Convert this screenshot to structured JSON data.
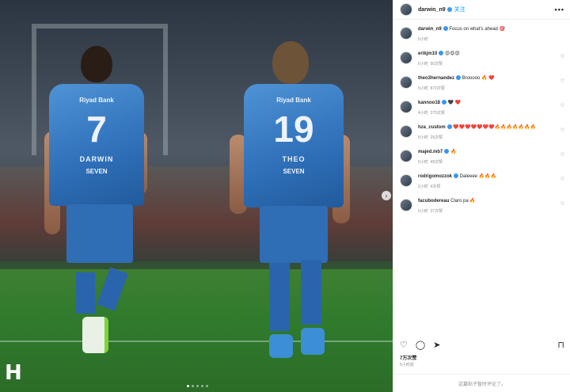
{
  "post": {
    "author": "darwin_n9",
    "follow_label": "关注",
    "more_label": "•••",
    "caption": {
      "user": "darwin_n9",
      "text": "Focus on what's ahead 🎯",
      "time": "5小时"
    },
    "comments": [
      {
        "user": "erikjm10",
        "text": "😍😍😍",
        "time": "5小时",
        "likes": "50次赞"
      },
      {
        "user": "theo3hernandez",
        "text": "Brooooo 🔥 ❤️",
        "time": "5小时",
        "likes": "872次赞"
      },
      {
        "user": "kannoo18",
        "text": "🖤 ❤️",
        "time": "4小时",
        "likes": "275次赞"
      },
      {
        "user": "hza_custom",
        "text": "❤️❤️❤️❤️❤️❤️❤️🔥🔥🔥🔥🔥🔥🔥",
        "time": "5小时",
        "likes": "29次赞"
      },
      {
        "user": "majed.mb7",
        "text": "🔥",
        "time": "5小时",
        "likes": "49次赞"
      },
      {
        "user": "rodrigomozzok",
        "text": "Daleeee 🔥🔥🔥",
        "time": "2小时",
        "likes": "4次赞"
      },
      {
        "user": "facubodereau",
        "text": "Claro pa 🔥",
        "time": "5小时",
        "likes": "37次赞"
      }
    ],
    "likes_total": "7万次赞",
    "posted_ago": "5小时前",
    "comments_disabled": "这篇帖子暂时评论了。"
  },
  "photo": {
    "player_left": {
      "number": "7",
      "name": "DARWIN",
      "sponsor": "SEVEN",
      "bank": "Riyad Bank"
    },
    "player_right": {
      "number": "19",
      "name": "THEO",
      "sponsor": "SEVEN",
      "bank": "Riyad Bank"
    },
    "club_logo": "H",
    "next_icon": "chevron-right-icon"
  },
  "colors": {
    "accent": "#0095f6",
    "shirt": "#2e6fb8",
    "pitch": "#2f7a2c"
  }
}
